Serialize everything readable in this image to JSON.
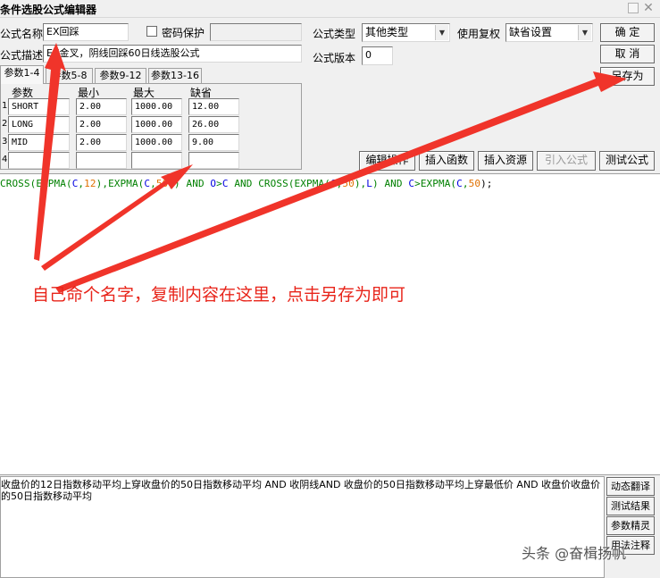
{
  "window": {
    "title": "条件选股公式编辑器"
  },
  "form": {
    "name_label": "公式名称",
    "name_value": "EX回踩",
    "password_label": "密码保护",
    "password_checked": false,
    "desc_label": "公式描述",
    "desc_value": "EX金叉，阴线回踩60日线选股公式",
    "type_label": "公式类型",
    "type_value": "其他类型",
    "rights_label": "使用复权",
    "rights_value": "缺省设置",
    "version_label": "公式版本",
    "version_value": "0"
  },
  "buttons": {
    "ok": "确  定",
    "cancel": "取  消",
    "save_as": "另存为",
    "edit_op": "编辑操作",
    "insert_func": "插入函数",
    "insert_res": "插入资源",
    "import_formula": "引入公式",
    "test_formula": "测试公式"
  },
  "tabs": [
    "参数1-4",
    "参数5-8",
    "参数9-12",
    "参数13-16"
  ],
  "params": {
    "headers": [
      "参数",
      "最小",
      "最大",
      "缺省"
    ],
    "rows": [
      {
        "num": "1",
        "name": "SHORT",
        "min": "2.00",
        "max": "1000.00",
        "default": "12.00"
      },
      {
        "num": "2",
        "name": "LONG",
        "min": "2.00",
        "max": "1000.00",
        "default": "26.00"
      },
      {
        "num": "3",
        "name": "MID",
        "min": "2.00",
        "max": "1000.00",
        "default": "9.00"
      },
      {
        "num": "4",
        "name": "",
        "min": "",
        "max": "",
        "default": ""
      }
    ]
  },
  "code": {
    "tokens": [
      {
        "t": "CROSS(",
        "c": "g"
      },
      {
        "t": "EXPMA(",
        "c": "g"
      },
      {
        "t": "C",
        "c": "b"
      },
      {
        "t": ",",
        "c": "g"
      },
      {
        "t": "12",
        "c": "o"
      },
      {
        "t": "),",
        "c": "g"
      },
      {
        "t": "EXPMA(",
        "c": "g"
      },
      {
        "t": "C",
        "c": "b"
      },
      {
        "t": ",",
        "c": "g"
      },
      {
        "t": "50",
        "c": "o"
      },
      {
        "t": ")) ",
        "c": "g"
      },
      {
        "t": "AND ",
        "c": "g"
      },
      {
        "t": "O",
        "c": "b"
      },
      {
        "t": ">",
        "c": "g"
      },
      {
        "t": "C ",
        "c": "b"
      },
      {
        "t": "AND ",
        "c": "g"
      },
      {
        "t": "CROSS(",
        "c": "g"
      },
      {
        "t": "EXPMA(",
        "c": "g"
      },
      {
        "t": "C",
        "c": "b"
      },
      {
        "t": ",",
        "c": "g"
      },
      {
        "t": "50",
        "c": "o"
      },
      {
        "t": "),",
        "c": "g"
      },
      {
        "t": "L",
        "c": "b"
      },
      {
        "t": ") ",
        "c": "g"
      },
      {
        "t": "AND ",
        "c": "g"
      },
      {
        "t": "C",
        "c": "b"
      },
      {
        "t": ">",
        "c": "g"
      },
      {
        "t": "EXPMA(",
        "c": "g"
      },
      {
        "t": "C",
        "c": "b"
      },
      {
        "t": ",",
        "c": "g"
      },
      {
        "t": "50",
        "c": "o"
      },
      {
        "t": ");",
        "c": "k"
      }
    ],
    "colors": {
      "g": "#008000",
      "b": "#0000e0",
      "o": "#e07000",
      "k": "#000000"
    }
  },
  "annotation": {
    "text": "自己命个名字，复制内容在这里，点击另存为即可",
    "color": "#e8241a"
  },
  "description": {
    "text": "收盘价的12日指数移动平均上穿收盘价的50日指数移动平均 AND 收阴线AND 收盘价的50日指数移动平均上穿最低价 AND 收盘价收盘价的50日指数移动平均"
  },
  "side_buttons": [
    "动态翻译",
    "测试结果",
    "参数精灵",
    "用法注释"
  ],
  "watermark": "头条 @奋楫扬帆",
  "icons": {
    "dropdown": "chevron-down-icon",
    "maximize": "maximize-icon",
    "close": "close-icon"
  }
}
